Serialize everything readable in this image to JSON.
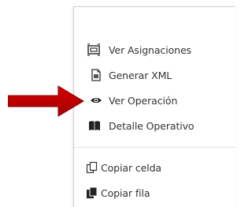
{
  "menu": {
    "items": [
      {
        "label": "Ver Asignaciones",
        "icon": "assignments-icon"
      },
      {
        "label": "Generar XML",
        "icon": "xml-file-icon"
      },
      {
        "label": "Ver Operación",
        "icon": "eye-icon"
      },
      {
        "label": "Detalle Operativo",
        "icon": "book-icon"
      }
    ],
    "clipboard_items": [
      {
        "label": "Copiar celda",
        "icon": "copy-cell-icon"
      },
      {
        "label": "Copiar fila",
        "icon": "copy-row-icon"
      }
    ]
  },
  "colors": {
    "arrow": "#c00000",
    "text": "#333333",
    "border": "#cfcfcf"
  }
}
